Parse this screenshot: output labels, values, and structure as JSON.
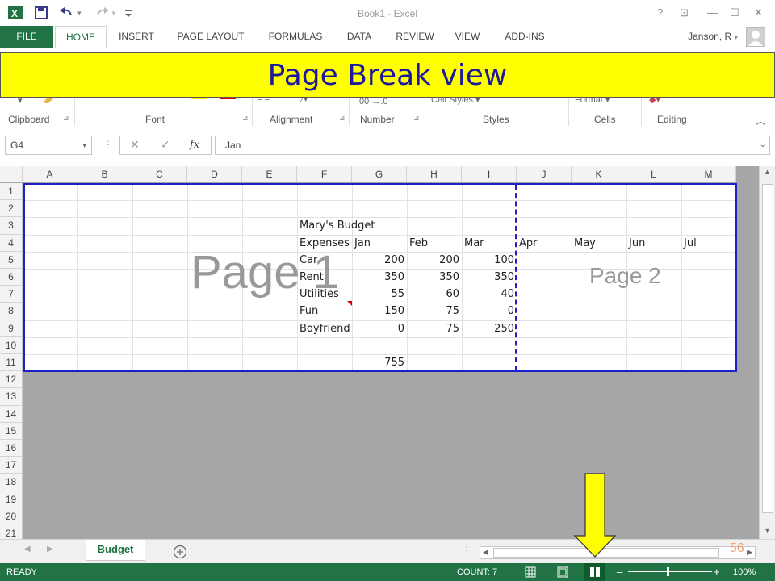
{
  "window": {
    "title": "Book1 - Excel",
    "controls": [
      "?",
      "⊡",
      "—",
      "☐",
      "✕"
    ]
  },
  "qat": {
    "icons": [
      "excel-logo-icon",
      "save-icon",
      "undo-icon",
      "redo-icon",
      "customize-icon"
    ]
  },
  "tabs": {
    "file": "FILE",
    "items": [
      "HOME",
      "INSERT",
      "PAGE LAYOUT",
      "FORMULAS",
      "DATA",
      "REVIEW",
      "VIEW",
      "ADD-INS"
    ],
    "active": "HOME",
    "user": "Janson, R"
  },
  "ribbon": {
    "groups": [
      "Clipboard",
      "Font",
      "Alignment",
      "Number",
      "Styles",
      "Cells",
      "Editing"
    ],
    "number_format": ".00 →.0",
    "cell_styles": "Cell Styles",
    "format": "Format"
  },
  "banner": {
    "text": "Page Break view"
  },
  "formula_bar": {
    "name_box": "G4",
    "fx": "fx",
    "value": "Jan"
  },
  "sheet": {
    "columns": [
      "A",
      "B",
      "C",
      "D",
      "E",
      "F",
      "G",
      "H",
      "I",
      "J",
      "K",
      "L",
      "M"
    ],
    "rows": [
      "1",
      "2",
      "3",
      "4",
      "5",
      "6",
      "7",
      "8",
      "9",
      "10",
      "11",
      "12",
      "13",
      "14",
      "15",
      "16",
      "17",
      "18",
      "19",
      "20",
      "21"
    ],
    "title_cell": "Mary's Budget",
    "header_row": [
      "Expenses",
      "Jan",
      "Feb",
      "Mar",
      "Apr",
      "May",
      "Jun",
      "Jul"
    ],
    "data_rows": [
      {
        "label": "Car",
        "values": [
          "200",
          "200",
          "100"
        ]
      },
      {
        "label": "Rent",
        "values": [
          "350",
          "350",
          "350"
        ]
      },
      {
        "label": "Utilities",
        "values": [
          "55",
          "60",
          "40"
        ]
      },
      {
        "label": "Fun",
        "values": [
          "150",
          "75",
          "0"
        ]
      },
      {
        "label": "Boyfriend",
        "values": [
          "0",
          "75",
          "250"
        ]
      }
    ],
    "total": "755",
    "watermarks": {
      "page1": "Page 1",
      "page2": "Page 2"
    }
  },
  "sheet_tabs": {
    "active": "Budget",
    "add": "+"
  },
  "status": {
    "ready": "READY",
    "count": "COUNT: 7",
    "zoom": "100%"
  },
  "slide_number": "56"
}
